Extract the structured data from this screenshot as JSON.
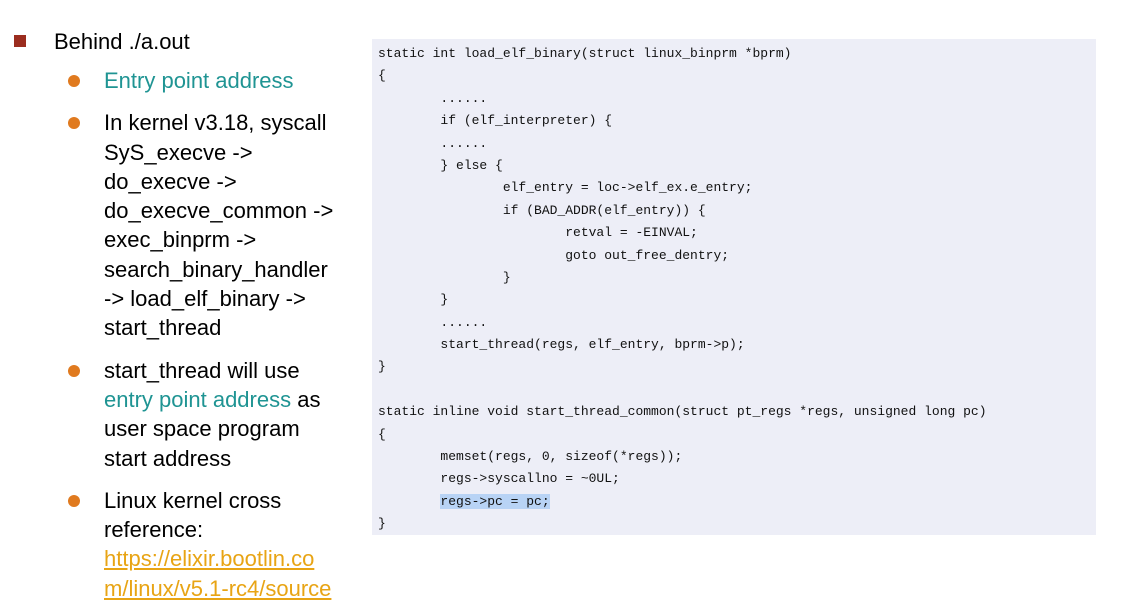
{
  "heading": "Behind ./a.out",
  "bullets": [
    {
      "lines": [
        "Entry point address"
      ]
    },
    {
      "lines": [
        "In kernel v3.18, syscall",
        "SyS_execve ->",
        "do_execve ->",
        "do_execve_common ->",
        "exec_binprm ->",
        "search_binary_handler",
        "-> load_elf_binary ->",
        "start_thread"
      ]
    },
    {
      "line1": "start_thread will use",
      "line2_teal": "entry point address",
      "line2_rest": " as",
      "line3": "user space program",
      "line4": "start address"
    },
    {
      "line1": "Linux kernel cross",
      "line2": "reference:",
      "link1": "https://elixir.bootlin.co",
      "link2": "m/linux/v5.1-rc4/source"
    }
  ],
  "code": {
    "lines": [
      "static int load_elf_binary(struct linux_binprm *bprm)",
      "{",
      "        ......",
      "        if (elf_interpreter) {",
      "        ......",
      "        } else {",
      "                elf_entry = loc->elf_ex.e_entry;",
      "                if (BAD_ADDR(elf_entry)) {",
      "                        retval = -EINVAL;",
      "                        goto out_free_dentry;",
      "                }",
      "        }",
      "        ......",
      "        start_thread(regs, elf_entry, bprm->p);",
      "}",
      "",
      "static inline void start_thread_common(struct pt_regs *regs, unsigned long pc)",
      "{",
      "        memset(regs, 0, sizeof(*regs));",
      "        regs->syscallno = ~0UL;",
      "}"
    ],
    "highlight_indent": "        ",
    "highlight_text": "regs->pc = pc;"
  }
}
